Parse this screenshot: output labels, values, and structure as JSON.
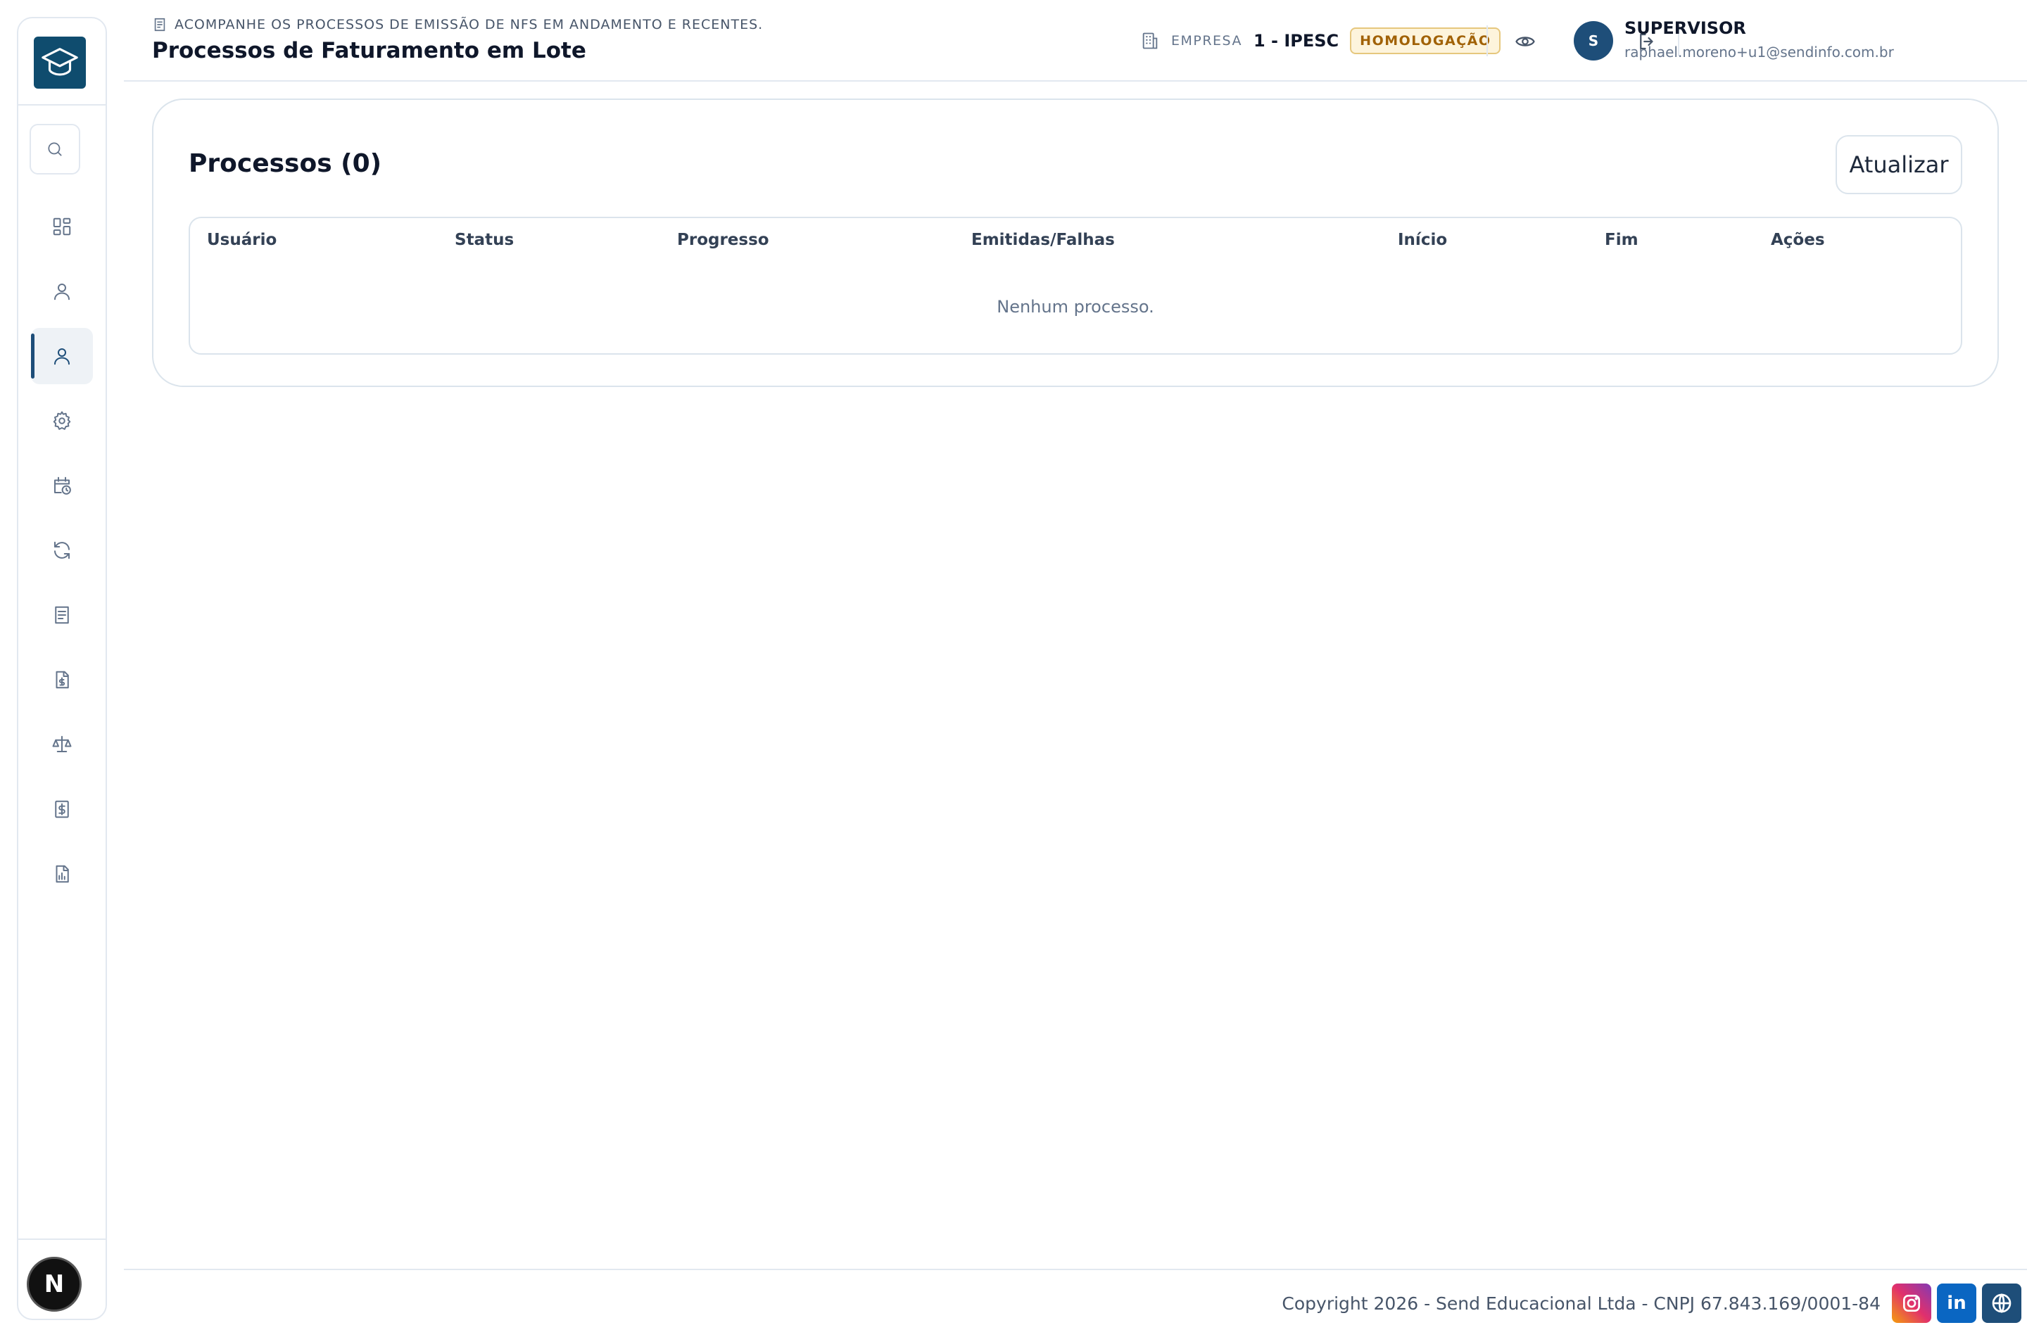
{
  "header": {
    "subtitle": "ACOMPANHE OS PROCESSOS DE EMISSÃO DE NFS EM ANDAMENTO E RECENTES.",
    "title": "Processos de Faturamento em Lote",
    "empresa_label": "EMPRESA",
    "empresa_value": "1 - IPESC",
    "env_badge": "HOMOLOGAÇÃO",
    "user": {
      "initial": "S",
      "role": "SUPERVISOR",
      "email": "raphael.moreno+u1@sendinfo.com.br"
    }
  },
  "sidebar": {
    "items": [
      {
        "icon": "search-icon"
      },
      {
        "icon": "dashboard-icon"
      },
      {
        "icon": "user-icon"
      },
      {
        "icon": "user-icon",
        "active": true
      },
      {
        "icon": "gear-icon"
      },
      {
        "icon": "calendar-clock-icon"
      },
      {
        "icon": "refresh-icon"
      },
      {
        "icon": "document-icon"
      },
      {
        "icon": "file-dollar-icon"
      },
      {
        "icon": "scale-icon"
      },
      {
        "icon": "receipt-dollar-icon"
      },
      {
        "icon": "report-chart-icon"
      }
    ],
    "badge": "N"
  },
  "main": {
    "card_title": "Processos (0)",
    "refresh_label": "Atualizar",
    "columns": [
      "Usuário",
      "Status",
      "Progresso",
      "Emitidas/Falhas",
      "Início",
      "Fim",
      "Ações"
    ],
    "rows": [],
    "empty_message": "Nenhum processo."
  },
  "footer": {
    "copyright": "Copyright 2026 - Send Educacional Ltda - CNPJ 67.843.169/0001-84",
    "social": [
      "instagram-icon",
      "linkedin-icon",
      "globe-icon"
    ]
  },
  "colors": {
    "brand": "#0f4c6e",
    "active_nav": "#1e4e79",
    "badge_bg": "#fdf4dc",
    "badge_text": "#a16207"
  }
}
